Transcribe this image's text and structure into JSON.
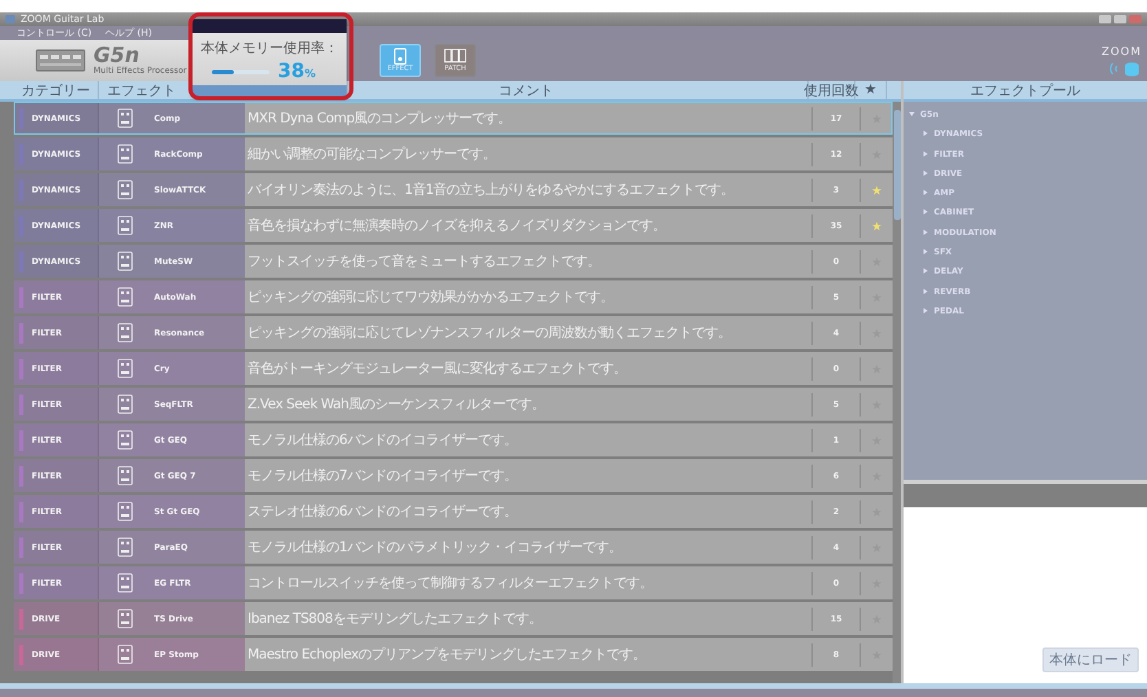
{
  "window": {
    "title": "ZOOM Guitar Lab"
  },
  "menu": [
    "コントロール (C)",
    "ヘルプ (H)"
  ],
  "device": {
    "model": "G5n",
    "subtitle": "Multi Effects Processor",
    "brand": "ZOOM"
  },
  "memory_popup": {
    "label": "本体メモリー使用率：",
    "reading": "38",
    "unit": "%",
    "level": 0.38
  },
  "mode_tabs": [
    {
      "label": "EFFECT",
      "selected": true
    },
    {
      "label": "PATCH",
      "selected": false
    }
  ],
  "table": {
    "columns": [
      "カテゴリー",
      "エフェクト",
      "コメント",
      "使用回数",
      "★"
    ],
    "rows": [
      {
        "category": "DYNAMICS",
        "color": "#7d78b8",
        "name": "Comp",
        "comment": "MXR Dyna Comp風のコンプレッサーです。",
        "count": "17",
        "favorite": false,
        "selected": true
      },
      {
        "category": "DYNAMICS",
        "color": "#7d78b8",
        "name": "RackComp",
        "comment": "細かい調整の可能なコンプレッサーです。",
        "count": "12",
        "favorite": false,
        "selected": false
      },
      {
        "category": "DYNAMICS",
        "color": "#7d78b8",
        "name": "SlowATTCK",
        "comment": "バイオリン奏法のように、1音1音の立ち上がりをゆるやかにするエフェクトです。",
        "count": "3",
        "favorite": true,
        "selected": false
      },
      {
        "category": "DYNAMICS",
        "color": "#7d78b8",
        "name": "ZNR",
        "comment": "音色を損なわずに無演奏時のノイズを抑えるノイズリダクションです。",
        "count": "35",
        "favorite": true,
        "selected": false
      },
      {
        "category": "DYNAMICS",
        "color": "#7d78b8",
        "name": "MuteSW",
        "comment": "フットスイッチを使って音をミュートするエフェクトです。",
        "count": "0",
        "favorite": false,
        "selected": false
      },
      {
        "category": "FILTER",
        "color": "#a878c0",
        "name": "AutoWah",
        "comment": "ピッキングの強弱に応じてワウ効果がかかるエフェクトです。",
        "count": "5",
        "favorite": false,
        "selected": false
      },
      {
        "category": "FILTER",
        "color": "#a878c0",
        "name": "Resonance",
        "comment": "ピッキングの強弱に応じてレゾナンスフィルターの周波数が動くエフェクトです。",
        "count": "4",
        "favorite": false,
        "selected": false
      },
      {
        "category": "FILTER",
        "color": "#a878c0",
        "name": "Cry",
        "comment": "音色がトーキングモジュレーター風に変化するエフェクトです。",
        "count": "0",
        "favorite": false,
        "selected": false
      },
      {
        "category": "FILTER",
        "color": "#a878c0",
        "name": "SeqFLTR",
        "comment": "Z.Vex Seek Wah風のシーケンスフィルターです。",
        "count": "5",
        "favorite": false,
        "selected": false
      },
      {
        "category": "FILTER",
        "color": "#a878c0",
        "name": "Gt GEQ",
        "comment": "モノラル仕様の6バンドのイコライザーです。",
        "count": "1",
        "favorite": false,
        "selected": false
      },
      {
        "category": "FILTER",
        "color": "#a878c0",
        "name": "Gt GEQ 7",
        "comment": "モノラル仕様の7バンドのイコライザーです。",
        "count": "6",
        "favorite": false,
        "selected": false
      },
      {
        "category": "FILTER",
        "color": "#a878c0",
        "name": "St Gt GEQ",
        "comment": "ステレオ仕様の6バンドのイコライザーです。",
        "count": "2",
        "favorite": false,
        "selected": false
      },
      {
        "category": "FILTER",
        "color": "#a878c0",
        "name": "ParaEQ",
        "comment": "モノラル仕様の1バンドのパラメトリック・イコライザーです。",
        "count": "4",
        "favorite": false,
        "selected": false
      },
      {
        "category": "FILTER",
        "color": "#a878c0",
        "name": "EG FLTR",
        "comment": "コントロールスイッチを使って制御するフィルターエフェクトです。",
        "count": "0",
        "favorite": false,
        "selected": false
      },
      {
        "category": "DRIVE",
        "color": "#c86898",
        "name": "TS Drive",
        "comment": "Ibanez TS808をモデリングしたエフェクトです。",
        "count": "15",
        "favorite": false,
        "selected": false
      },
      {
        "category": "DRIVE",
        "color": "#c86898",
        "name": "EP Stomp",
        "comment": "Maestro Echoplexのプリアンプをモデリングしたエフェクトです。",
        "count": "8",
        "favorite": false,
        "selected": false
      }
    ]
  },
  "effect_pool": {
    "title": "エフェクトプール",
    "tree": [
      {
        "label": "G5n",
        "expanded": true,
        "children": [
          {
            "label": "DYNAMICS",
            "expanded": false
          },
          {
            "label": "FILTER",
            "expanded": false
          },
          {
            "label": "DRIVE",
            "expanded": false
          },
          {
            "label": "AMP",
            "expanded": false
          },
          {
            "label": "CABINET",
            "expanded": false
          },
          {
            "label": "MODULATION",
            "expanded": false
          },
          {
            "label": "SFX",
            "expanded": false
          },
          {
            "label": "DELAY",
            "expanded": false
          },
          {
            "label": "REVERB",
            "expanded": false
          },
          {
            "label": "PEDAL",
            "expanded": false
          }
        ]
      }
    ]
  },
  "load_button": "本体にロード"
}
